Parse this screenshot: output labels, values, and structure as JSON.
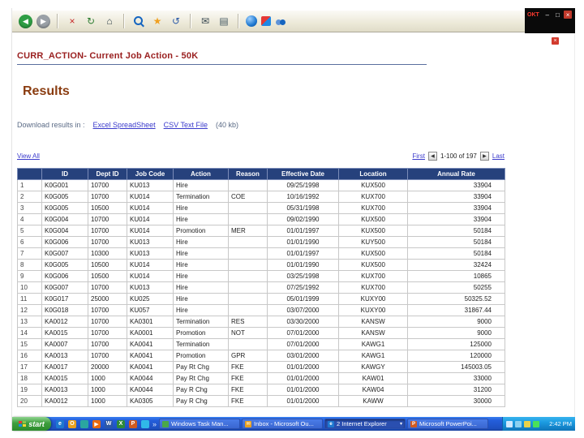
{
  "window": {
    "badge": "OKT",
    "controls": {
      "minimize": "–",
      "restore": "□",
      "close": "×"
    },
    "mini_close": "×"
  },
  "toolbar": {
    "icons": [
      {
        "name": "back-button",
        "glyph": "◀",
        "cls": "circle",
        "bg": "#2f9e44"
      },
      {
        "name": "forward-button",
        "glyph": "▶",
        "cls": "circle",
        "bg": "#9aa0a6"
      },
      {
        "name": "toolbar-separator",
        "cls": "sep",
        "static": true
      },
      {
        "name": "stop-icon",
        "glyph": "×",
        "fg": "#c62828"
      },
      {
        "name": "refresh-icon",
        "glyph": "↻",
        "fg": "#2e7d32"
      },
      {
        "name": "home-icon",
        "glyph": "⌂",
        "fg": "#37474f"
      },
      {
        "name": "toolbar-separator",
        "cls": "sep",
        "static": true
      },
      {
        "name": "search-icon",
        "cls": "mag"
      },
      {
        "name": "favorites-icon",
        "glyph": "★",
        "fg": "#f0a020"
      },
      {
        "name": "history-icon",
        "glyph": "↺",
        "fg": "#2e5ca8"
      },
      {
        "name": "toolbar-separator",
        "cls": "sep",
        "static": true
      },
      {
        "name": "mail-icon",
        "glyph": "✉",
        "fg": "#37474f"
      },
      {
        "name": "print-icon",
        "glyph": "▤",
        "fg": "#455a64"
      },
      {
        "name": "toolbar-separator",
        "cls": "sep",
        "static": true
      },
      {
        "name": "globe-app-icon",
        "cls": "ic-globe"
      },
      {
        "name": "messenger-icon",
        "cls": "ic-duo"
      },
      {
        "name": "people-icon",
        "cls": "ic-people"
      }
    ]
  },
  "page": {
    "title": "CURR_ACTION- Current Job Action - 50K",
    "results_heading": "Results",
    "download": {
      "label": "Download results in :",
      "excel": "Excel SpreadSheet",
      "csv": "CSV Text File",
      "size": "(40 kb)"
    },
    "pagination": {
      "view_all": "View All",
      "first": "First",
      "prev": "◀",
      "range": "1-100 of 197",
      "next": "▶",
      "last": "Last"
    }
  },
  "table": {
    "headers": [
      "ID",
      "Dept ID",
      "Job Code",
      "Action",
      "Reason",
      "Effective Date",
      "Location",
      "Annual Rate"
    ],
    "rows": [
      {
        "num": "1",
        "cells": [
          "K0G001",
          "10700",
          "KU013",
          "Hire",
          "",
          "09/25/1998",
          "KUX500",
          "33904"
        ]
      },
      {
        "num": "2",
        "cells": [
          "K0G005",
          "10700",
          "KU014",
          "Termination",
          "COE",
          "10/16/1992",
          "KUX700",
          "33904"
        ]
      },
      {
        "num": "3",
        "cells": [
          "K0G005",
          "10500",
          "KU014",
          "Hire",
          "",
          "05/31/1998",
          "KUX700",
          "33904"
        ]
      },
      {
        "num": "4",
        "cells": [
          "K0G004",
          "10700",
          "KU014",
          "Hire",
          "",
          "09/02/1990",
          "KUX500",
          "33904"
        ]
      },
      {
        "num": "5",
        "cells": [
          "K0G004",
          "10700",
          "KU014",
          "Promotion",
          "MER",
          "01/01/1997",
          "KUX500",
          "50184"
        ]
      },
      {
        "num": "6",
        "cells": [
          "K0G006",
          "10700",
          "KU013",
          "Hire",
          "",
          "01/01/1990",
          "KUY500",
          "50184"
        ]
      },
      {
        "num": "7",
        "cells": [
          "K0G007",
          "10300",
          "KU013",
          "Hire",
          "",
          "01/01/1997",
          "KUX500",
          "50184"
        ]
      },
      {
        "num": "8",
        "cells": [
          "K0G005",
          "10500",
          "KU014",
          "Hire",
          "",
          "01/01/1990",
          "KUX500",
          "32424"
        ]
      },
      {
        "num": "9",
        "cells": [
          "K0G006",
          "10500",
          "KU014",
          "Hire",
          "",
          "03/25/1998",
          "KUX700",
          "10865"
        ]
      },
      {
        "num": "10",
        "cells": [
          "K0G007",
          "10700",
          "KU013",
          "Hire",
          "",
          "07/25/1992",
          "KUX700",
          "50255"
        ]
      },
      {
        "num": "11",
        "cells": [
          "K0G017",
          "25000",
          "KU025",
          "Hire",
          "",
          "05/01/1999",
          "KUXY00",
          "50325.52"
        ]
      },
      {
        "num": "12",
        "cells": [
          "K0G018",
          "10700",
          "KU057",
          "Hire",
          "",
          "03/07/2000",
          "KUXY00",
          "31867.44"
        ]
      },
      {
        "num": "13",
        "cells": [
          "KA0012",
          "10700",
          "KA0301",
          "Termination",
          "RES",
          "03/30/2000",
          "KANSW",
          "9000"
        ]
      },
      {
        "num": "14",
        "cells": [
          "KA0015",
          "10700",
          "KA0001",
          "Promotion",
          "NOT",
          "07/01/2000",
          "KANSW",
          "9000"
        ]
      },
      {
        "num": "15",
        "cells": [
          "KA0007",
          "10700",
          "KA0041",
          "Termination",
          "",
          "07/01/2000",
          "KAWG1",
          "125000"
        ]
      },
      {
        "num": "16",
        "cells": [
          "KA0013",
          "10700",
          "KA0041",
          "Promotion",
          "GPR",
          "03/01/2000",
          "KAWG1",
          "120000"
        ]
      },
      {
        "num": "17",
        "cells": [
          "KA0017",
          "20000",
          "KA0041",
          "Pay Rt Chg",
          "FKE",
          "01/01/2000",
          "KAWGY",
          "145003.05"
        ]
      },
      {
        "num": "18",
        "cells": [
          "KA0015",
          "1000",
          "KA0044",
          "Pay Rt Chg",
          "FKE",
          "01/01/2000",
          "KAW01",
          "33000"
        ]
      },
      {
        "num": "19",
        "cells": [
          "KA0013",
          "1000",
          "KA0044",
          "Pay R Chg",
          "FKE",
          "01/01/2000",
          "KAW04",
          "31200"
        ]
      },
      {
        "num": "20",
        "cells": [
          "KA0012",
          "1000",
          "KA0305",
          "Pay R Chg",
          "FKE",
          "01/01/2000",
          "KAWW",
          "30000"
        ]
      }
    ]
  },
  "taskbar": {
    "start_label": "start",
    "overflow": "»",
    "quick_launch": [
      {
        "name": "internet-explorer-icon",
        "glyph": "e",
        "bg": "#1e78d0"
      },
      {
        "name": "outlook-icon",
        "glyph": "O",
        "bg": "#e8a020"
      },
      {
        "name": "show-desktop-icon",
        "glyph": "",
        "bg": "#2aa6a0"
      },
      {
        "name": "media-player-icon",
        "glyph": "▶",
        "bg": "#e86a10"
      },
      {
        "name": "word-icon",
        "glyph": "W",
        "bg": "#2b57a8"
      },
      {
        "name": "excel-icon",
        "glyph": "X",
        "bg": "#2e8a3a"
      },
      {
        "name": "powerpoint-icon",
        "glyph": "P",
        "bg": "#d05a20"
      },
      {
        "name": "msn-icon",
        "glyph": "",
        "bg": "#30b8e8"
      }
    ],
    "buttons": [
      {
        "label": "Windows Task Man...",
        "icon": "task-manager-icon",
        "icon_bg": "#4aa84a",
        "glyph": ""
      },
      {
        "label": "Inbox - Microsoft Ou...",
        "icon": "outlook-icon",
        "icon_bg": "#e8a020",
        "glyph": "✉"
      },
      {
        "label": "2 Internet Explorer",
        "icon": "internet-explorer-icon",
        "icon_bg": "#1e78d0",
        "glyph": "e",
        "dropdown": "▾",
        "pressed": true
      },
      {
        "label": "Microsoft PowerPoi...",
        "icon": "powerpoint-icon",
        "icon_bg": "#d05a20",
        "glyph": "P"
      }
    ],
    "tray": {
      "time": "2:42 PM",
      "icons": [
        {
          "name": "volume-icon",
          "color": "#cfe8ff"
        },
        {
          "name": "network-icon",
          "color": "#8bd0f0"
        },
        {
          "name": "antivirus-icon",
          "color": "#e8d24a"
        },
        {
          "name": "messenger-tray-icon",
          "color": "#4ae05a"
        }
      ]
    }
  },
  "colors": {
    "page_bg": "#ffffff",
    "toolbar_bg": "#ece9d8",
    "header_bg": "#26417c",
    "header_fg": "#ffffff",
    "title_color": "#9a2020",
    "results_color": "#8a3c10",
    "link_color": "#3a3acc",
    "taskbar_blue": "#245edb",
    "start_green": "#3d9e3d",
    "tray_blue": "#1b9ae0",
    "grid_color": "#c8c8c8"
  }
}
